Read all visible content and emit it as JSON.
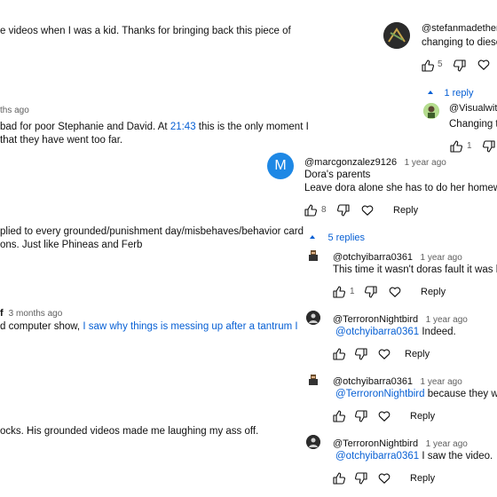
{
  "top_comment": {
    "text": "e videos when I was a kid. Thanks for bringing back this piece of"
  },
  "comment2": {
    "time": "ths ago",
    "line1_before": "bad for poor Stephanie and David. At ",
    "timestamp_link": "21:43",
    "line1_after": " this is the only moment I",
    "line2": "that they have went too far."
  },
  "comment3": {
    "line1": "plied to every grounded/punishment day/misbehaves/behavior card",
    "line2": "ons. Just like Phineas and Ferb"
  },
  "comment4": {
    "handle_tail": "f",
    "time": "3 months ago",
    "line1_before": "d computer show, ",
    "line1_link": "I saw why things is messing up after a tantrum I"
  },
  "comment5": {
    "text": "ocks. His grounded videos made me laughing my ass off."
  },
  "right_top": {
    "handle": "@stefanmadethen",
    "text": "changing to diese",
    "likes": "5",
    "replies_toggle": "1 reply",
    "reply": {
      "handle": "@Visualwit",
      "text": "Changing to",
      "likes": "1"
    }
  },
  "marc_comment": {
    "avatar_letter": "M",
    "avatar_color": "#1e88e5",
    "handle": "@marcgonzalez9126",
    "time": "1 year ago",
    "line1": "Dora's parents",
    "line2": "Leave dora alone she has to do her homewo",
    "likes": "8",
    "reply_label": "Reply",
    "replies_toggle": "5 replies"
  },
  "replies": [
    {
      "handle": "@otchyibarra0361",
      "time": "1 year ago",
      "text": "This time it wasn't doras fault it was he",
      "mention": "",
      "likes": "1",
      "reply_label": "Reply"
    },
    {
      "handle": "@TerroronNightbird",
      "time": "1 year ago",
      "mention": "@otchyibarra0361",
      "text": " Indeed.",
      "likes": "",
      "reply_label": "Reply"
    },
    {
      "handle": "@otchyibarra0361",
      "time": "1 year ago",
      "mention": "@TerroronNightbird",
      "text": " because they w",
      "likes": "",
      "reply_label": "Reply"
    },
    {
      "handle": "@TerroronNightbird",
      "time": "1 year ago",
      "mention": "@otchyibarra0361",
      "text": " I saw the video.",
      "likes": "",
      "reply_label": "Reply"
    }
  ]
}
